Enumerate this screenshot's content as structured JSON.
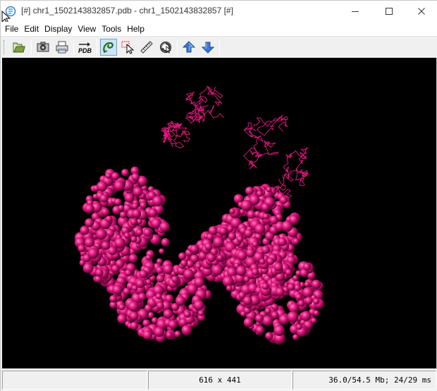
{
  "window": {
    "title": "[#] chr1_1502143832857.pdb - chr1_1502143832857 [#]"
  },
  "menu": {
    "items": [
      "File",
      "Edit",
      "Display",
      "View",
      "Tools",
      "Help"
    ]
  },
  "toolbar": {
    "buttons": [
      {
        "icon": "open-file-icon"
      },
      {
        "icon": "camera-icon"
      },
      {
        "icon": "print-icon"
      },
      {
        "icon": "export-pdb-icon",
        "text": "PDB"
      },
      {
        "icon": "rotate-icon",
        "active": true
      },
      {
        "icon": "select-pointer-icon"
      },
      {
        "icon": "measure-ruler-icon"
      },
      {
        "icon": "spin-icon"
      },
      {
        "icon": "arrow-up-icon"
      },
      {
        "icon": "arrow-down-icon"
      }
    ]
  },
  "viewer": {
    "background": "#000000",
    "molecule_color": "#e0187c"
  },
  "status": {
    "left": "",
    "dimensions": "616 x 441",
    "memory": "36.0/54.5 Mb;",
    "timing": "24/29 ms"
  }
}
